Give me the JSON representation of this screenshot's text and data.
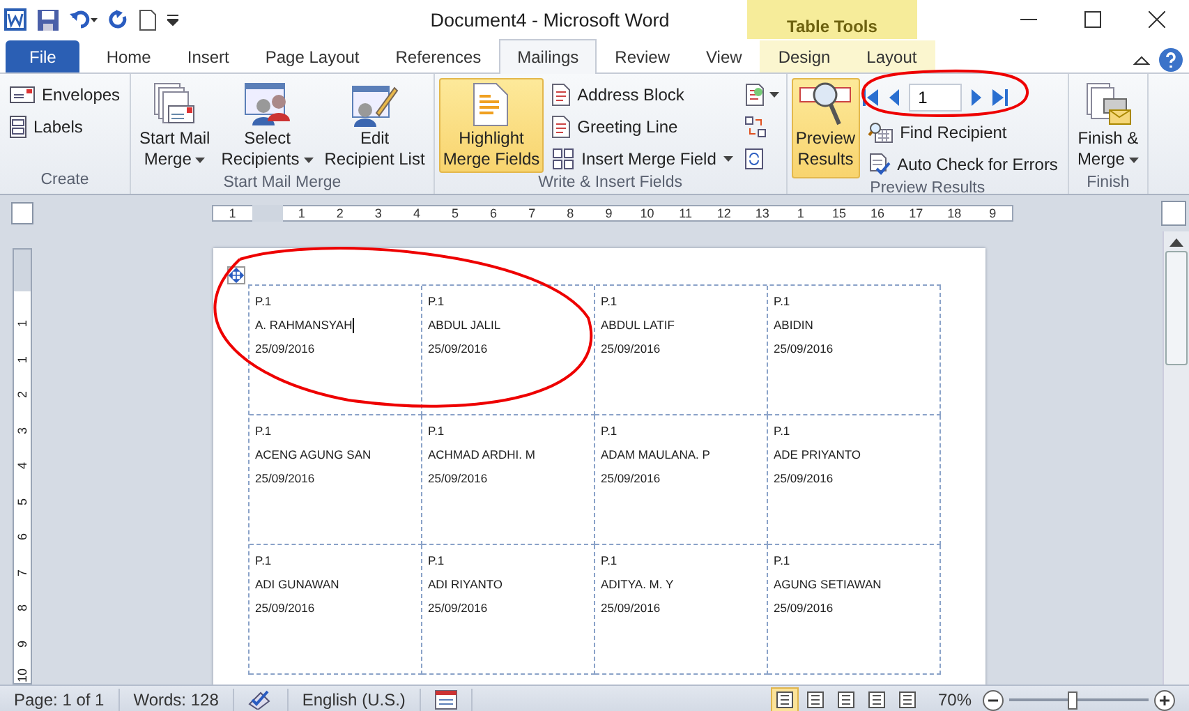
{
  "title_bar": {
    "title": "Document4  -  Microsoft Word",
    "context_group": "Table Tools"
  },
  "tabs": [
    {
      "label": "File",
      "kind": "file",
      "selected": false
    },
    {
      "label": "Home",
      "kind": "normal",
      "selected": false
    },
    {
      "label": "Insert",
      "kind": "normal",
      "selected": false
    },
    {
      "label": "Page Layout",
      "kind": "normal",
      "selected": false
    },
    {
      "label": "References",
      "kind": "normal",
      "selected": false
    },
    {
      "label": "Mailings",
      "kind": "normal",
      "selected": true
    },
    {
      "label": "Review",
      "kind": "normal",
      "selected": false
    },
    {
      "label": "View",
      "kind": "normal",
      "selected": false
    },
    {
      "label": "Design",
      "kind": "context",
      "selected": false
    },
    {
      "label": "Layout",
      "kind": "context",
      "selected": false
    }
  ],
  "ribbon": {
    "groups": [
      {
        "label": "Create",
        "items": [
          {
            "kind": "small",
            "label": "Envelopes",
            "dropdown": false,
            "selected": false
          },
          {
            "kind": "small",
            "label": "Labels",
            "dropdown": false,
            "selected": false
          }
        ]
      },
      {
        "label": "Start Mail Merge",
        "items": [
          {
            "kind": "large",
            "label": "Start Mail",
            "label2": "Merge",
            "dropdown": true,
            "selected": false
          },
          {
            "kind": "large",
            "label": "Select",
            "label2": "Recipients",
            "dropdown": true,
            "selected": false
          },
          {
            "kind": "large",
            "label": "Edit",
            "label2": "Recipient List",
            "dropdown": false,
            "selected": false
          }
        ]
      },
      {
        "label": "Write & Insert Fields",
        "items": [
          {
            "kind": "large",
            "label": "Highlight",
            "label2": "Merge Fields",
            "dropdown": false,
            "selected": true
          },
          {
            "kind": "small",
            "label": "Address Block",
            "dropdown": false,
            "selected": false
          },
          {
            "kind": "small",
            "label": "Greeting Line",
            "dropdown": false,
            "selected": false
          },
          {
            "kind": "small",
            "label": "Insert Merge Field",
            "dropdown": true,
            "selected": false
          },
          {
            "kind": "tool",
            "dropdown": true,
            "selected": false
          },
          {
            "kind": "tool",
            "dropdown": false,
            "selected": false
          },
          {
            "kind": "tool",
            "dropdown": false,
            "selected": false
          }
        ]
      },
      {
        "label": "Preview Results",
        "items": [
          {
            "kind": "large",
            "label": "Preview",
            "label2": "Results",
            "dropdown": false,
            "selected": true
          },
          {
            "kind": "nav",
            "record": "1"
          },
          {
            "kind": "small",
            "label": "Find Recipient",
            "dropdown": false,
            "selected": false
          },
          {
            "kind": "small",
            "label": "Auto Check for Errors",
            "dropdown": false,
            "selected": false
          }
        ]
      },
      {
        "label": "Finish",
        "items": [
          {
            "kind": "large",
            "label": "Finish &",
            "label2": "Merge",
            "dropdown": true,
            "selected": false
          }
        ]
      }
    ]
  },
  "ruler": [
    "1",
    "1",
    "2",
    "3",
    "4",
    "5",
    "6",
    "7",
    "8",
    "9",
    "10",
    "11",
    "12",
    "13",
    "1",
    "15",
    "16",
    "17",
    "18",
    "9"
  ],
  "vruler": [
    "1",
    "1",
    "2",
    "3",
    "4",
    "5",
    "6",
    "7",
    "8",
    "9",
    "10"
  ],
  "labels": [
    [
      {
        "code": "P.1",
        "name": "A. RAHMANSYAH",
        "date": "25/09/2016",
        "cursor": true
      },
      {
        "code": "P.1",
        "name": "ABDUL JALIL",
        "date": "25/09/2016",
        "cursor": false
      },
      {
        "code": "P.1",
        "name": "ABDUL LATIF",
        "date": "25/09/2016",
        "cursor": false
      },
      {
        "code": "P.1",
        "name": "ABIDIN",
        "date": "25/09/2016",
        "cursor": false
      }
    ],
    [
      {
        "code": "P.1",
        "name": "ACENG AGUNG SAN",
        "date": "25/09/2016",
        "cursor": false
      },
      {
        "code": "P.1",
        "name": "ACHMAD ARDHI. M",
        "date": "25/09/2016",
        "cursor": false
      },
      {
        "code": "P.1",
        "name": "ADAM MAULANA. P",
        "date": "25/09/2016",
        "cursor": false
      },
      {
        "code": "P.1",
        "name": "ADE PRIYANTO",
        "date": "25/09/2016",
        "cursor": false
      }
    ],
    [
      {
        "code": "P.1",
        "name": "ADI GUNAWAN",
        "date": "25/09/2016",
        "cursor": false
      },
      {
        "code": "P.1",
        "name": "ADI RIYANTO",
        "date": "25/09/2016",
        "cursor": false
      },
      {
        "code": "P.1",
        "name": "ADITYA. M. Y",
        "date": "25/09/2016",
        "cursor": false
      },
      {
        "code": "P.1",
        "name": "AGUNG SETIAWAN",
        "date": "25/09/2016",
        "cursor": false
      }
    ]
  ],
  "status_bar": {
    "page": "Page: 1 of 1",
    "words": "Words: 128",
    "language": "English (U.S.)",
    "zoom": "70%",
    "zoom_slider": {
      "level": 0.45
    },
    "views": [
      {
        "selected": true
      },
      {
        "selected": false
      },
      {
        "selected": false
      },
      {
        "selected": false
      },
      {
        "selected": false
      }
    ]
  }
}
